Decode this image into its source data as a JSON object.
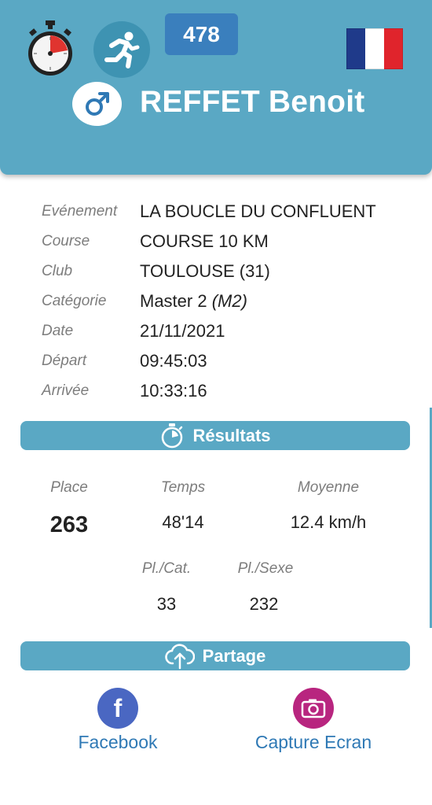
{
  "header": {
    "bib_number": "478",
    "name": "REFFET Benoit",
    "gender_icon": "male-symbol-icon",
    "flag": "france-flag",
    "colors": {
      "header_bg": "#5aa8c4",
      "bib_bg": "#3a7fbd"
    }
  },
  "info": {
    "rows": [
      {
        "label": "Evénement",
        "value": "LA BOUCLE DU CONFLUENT"
      },
      {
        "label": "Course",
        "value": "COURSE 10 KM"
      },
      {
        "label": "Club",
        "value": "TOULOUSE (31)"
      },
      {
        "label": "Catégorie",
        "value": "Master 2",
        "extra": "(M2)"
      },
      {
        "label": "Date",
        "value": "21/11/2021"
      },
      {
        "label": "Départ",
        "value": "09:45:03"
      },
      {
        "label": "Arrivée",
        "value": "10:33:16"
      }
    ]
  },
  "results": {
    "title": "Résultats",
    "place_label": "Place",
    "place_value": "263",
    "time_label": "Temps",
    "time_value": "48'14",
    "avg_label": "Moyenne",
    "avg_value": "12.4 km/h",
    "cat_label": "Pl./Cat.",
    "cat_value": "33",
    "sex_label": "Pl./Sexe",
    "sex_value": "232"
  },
  "share": {
    "title": "Partage",
    "facebook_label": "Facebook",
    "capture_label": "Capture Ecran"
  }
}
